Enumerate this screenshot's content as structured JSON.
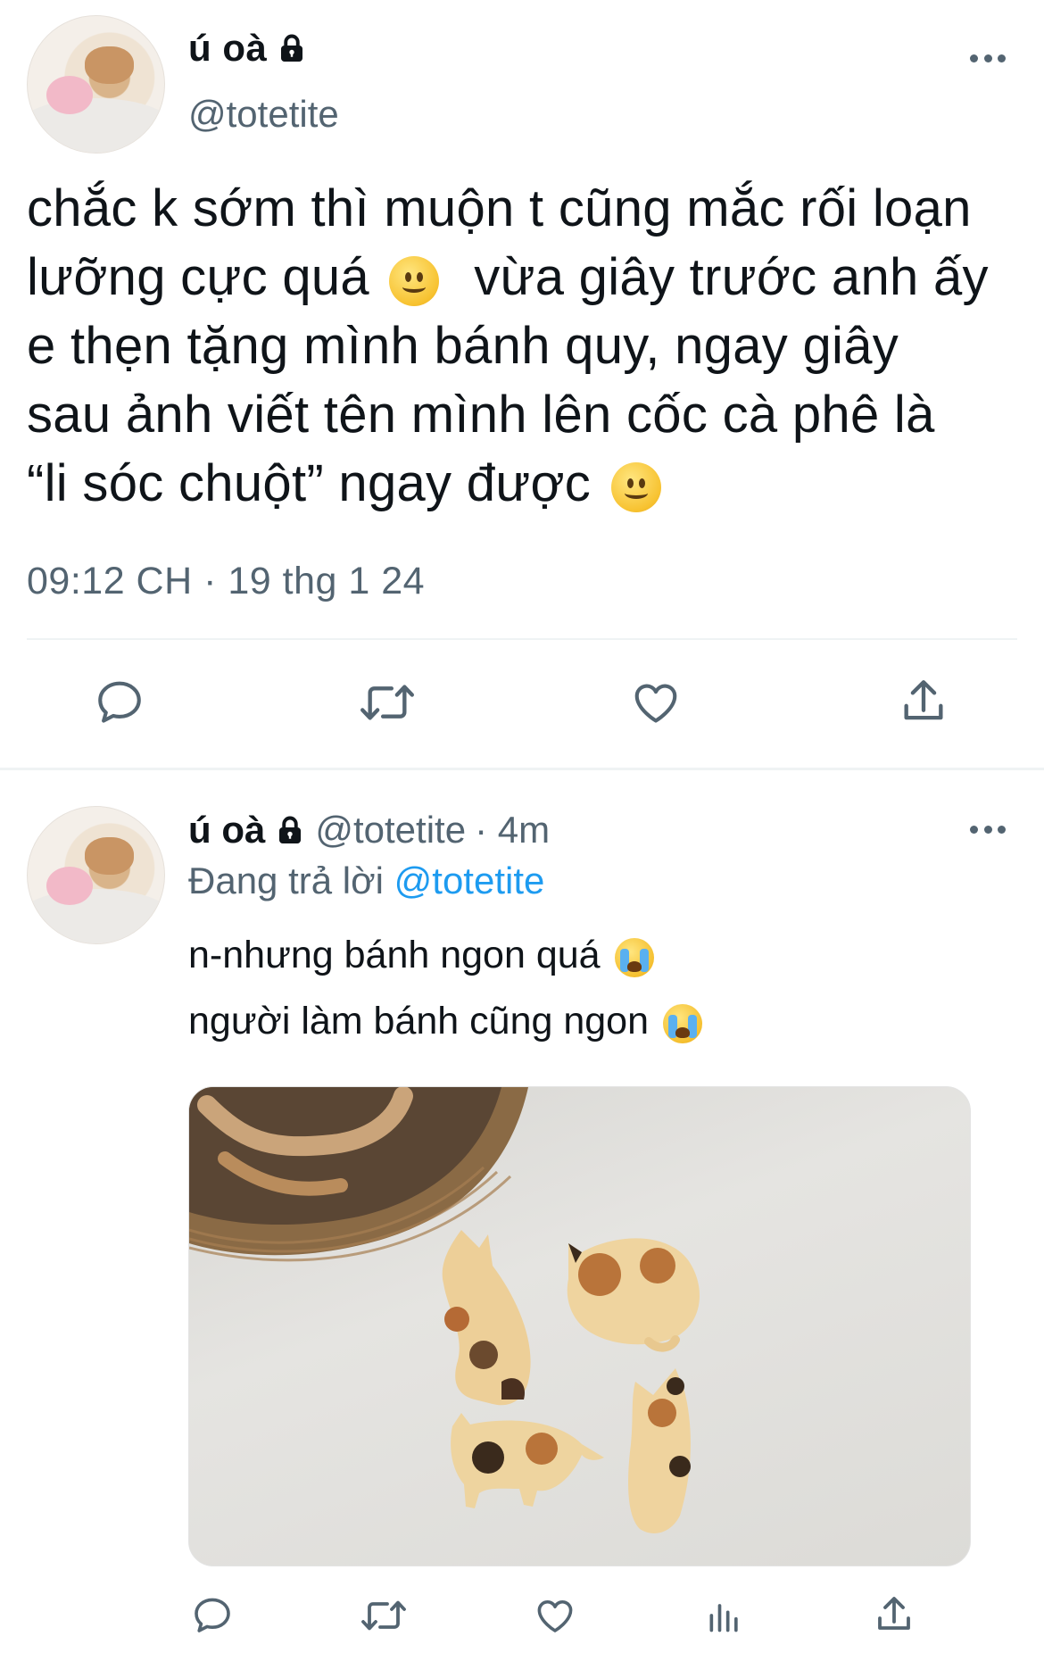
{
  "main_tweet": {
    "display_name": "ú oà",
    "handle": "@totetite",
    "text": "chắc k sớm thì muộn t cũng mắc rối loạn\nlưỡng cực quá 🙂 vừa giây trước anh ấy\ne thẹn tặng mình bánh quy, ngay giây\nsau ảnh viết tên mình lên cốc cà phê là\n“li sóc chuột” ngay được 🙂",
    "text_lines": [
      "chắc k sớm thì muộn t cũng mắc rối loạn",
      "lưỡng cực quá",
      "vừa giây trước anh ấy",
      "e thẹn tặng mình bánh quy, ngay giây",
      "sau ảnh viết tên mình lên cốc cà phê là",
      "“li sóc chuột” ngay được"
    ],
    "timestamp": "09:12 CH · 19 thg 1 24",
    "icons": {
      "lock": "lock-icon",
      "more": "more-icon",
      "actions": [
        "reply-icon",
        "retweet-icon",
        "like-icon",
        "share-icon"
      ]
    }
  },
  "reply": {
    "display_name": "ú oà",
    "handle": "@totetite",
    "age": "· 4m",
    "replying_prefix": "Đang trả lời",
    "replying_to": "@totetite",
    "lines": [
      "n-nhưng bánh ngon quá",
      "người làm bánh cũng ngon"
    ],
    "media_alt": "cat-shaped cookies photo",
    "icons": {
      "actions": [
        "reply-icon",
        "retweet-icon",
        "like-icon",
        "analytics-icon",
        "share-icon"
      ]
    }
  },
  "colors": {
    "text": "#0f1419",
    "secondary": "#536471",
    "link": "#1d9bf0",
    "divider": "#eff3f4"
  }
}
